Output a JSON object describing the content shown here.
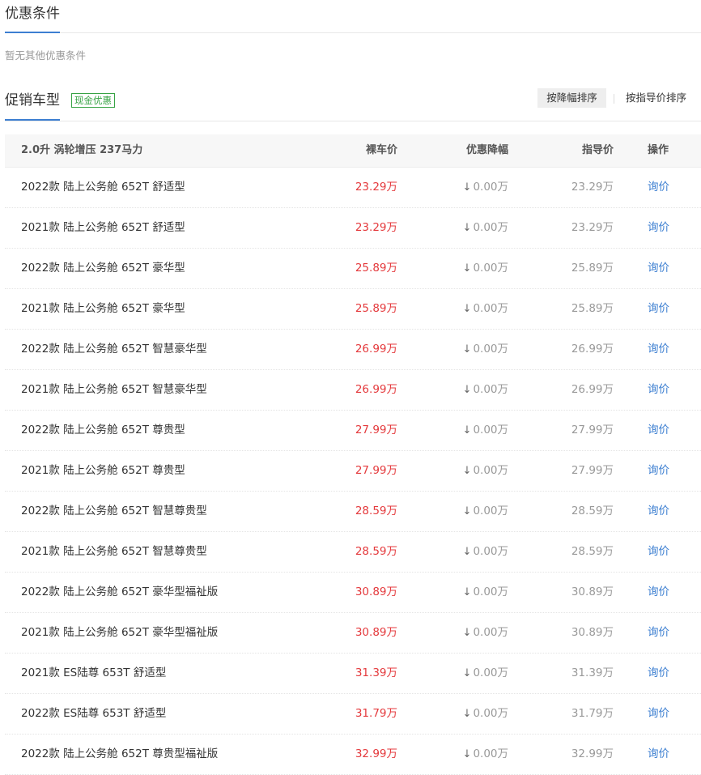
{
  "discount_section": {
    "title": "优惠条件",
    "note": "暂无其他优惠条件"
  },
  "promo_section": {
    "title": "促销车型",
    "tag": "现金优惠",
    "sort_by_discount": "按降幅排序",
    "sort_by_guide": "按指导价排序"
  },
  "table": {
    "group_title": "2.0升 涡轮增压 237马力",
    "col_price": "裸车价",
    "col_discount": "优惠降幅",
    "col_guide": "指导价",
    "col_action": "操作",
    "rows": [
      {
        "name": "2022款 陆上公务舱 652T 舒适型",
        "price": "23.29万",
        "discount": "0.00万",
        "guide": "23.29万",
        "action": "询价"
      },
      {
        "name": "2021款 陆上公务舱 652T 舒适型",
        "price": "23.29万",
        "discount": "0.00万",
        "guide": "23.29万",
        "action": "询价"
      },
      {
        "name": "2022款 陆上公务舱 652T 豪华型",
        "price": "25.89万",
        "discount": "0.00万",
        "guide": "25.89万",
        "action": "询价"
      },
      {
        "name": "2021款 陆上公务舱 652T 豪华型",
        "price": "25.89万",
        "discount": "0.00万",
        "guide": "25.89万",
        "action": "询价"
      },
      {
        "name": "2022款 陆上公务舱 652T 智慧豪华型",
        "price": "26.99万",
        "discount": "0.00万",
        "guide": "26.99万",
        "action": "询价"
      },
      {
        "name": "2021款 陆上公务舱 652T 智慧豪华型",
        "price": "26.99万",
        "discount": "0.00万",
        "guide": "26.99万",
        "action": "询价"
      },
      {
        "name": "2022款 陆上公务舱 652T 尊贵型",
        "price": "27.99万",
        "discount": "0.00万",
        "guide": "27.99万",
        "action": "询价"
      },
      {
        "name": "2021款 陆上公务舱 652T 尊贵型",
        "price": "27.99万",
        "discount": "0.00万",
        "guide": "27.99万",
        "action": "询价"
      },
      {
        "name": "2022款 陆上公务舱 652T 智慧尊贵型",
        "price": "28.59万",
        "discount": "0.00万",
        "guide": "28.59万",
        "action": "询价"
      },
      {
        "name": "2021款 陆上公务舱 652T 智慧尊贵型",
        "price": "28.59万",
        "discount": "0.00万",
        "guide": "28.59万",
        "action": "询价"
      },
      {
        "name": "2022款 陆上公务舱 652T 豪华型福祉版",
        "price": "30.89万",
        "discount": "0.00万",
        "guide": "30.89万",
        "action": "询价"
      },
      {
        "name": "2021款 陆上公务舱 652T 豪华型福祉版",
        "price": "30.89万",
        "discount": "0.00万",
        "guide": "30.89万",
        "action": "询价"
      },
      {
        "name": "2021款 ES陆尊 653T 舒适型",
        "price": "31.39万",
        "discount": "0.00万",
        "guide": "31.39万",
        "action": "询价"
      },
      {
        "name": "2022款 ES陆尊 653T 舒适型",
        "price": "31.79万",
        "discount": "0.00万",
        "guide": "31.79万",
        "action": "询价"
      },
      {
        "name": "2022款 陆上公务舱 652T 尊贵型福祉版",
        "price": "32.99万",
        "discount": "0.00万",
        "guide": "32.99万",
        "action": "询价"
      }
    ]
  },
  "icons": {
    "discount_arrow": "arrow-down-icon"
  },
  "colors": {
    "accent": "#3d7fd1",
    "price": "#e4393c",
    "tag": "#37a344"
  }
}
